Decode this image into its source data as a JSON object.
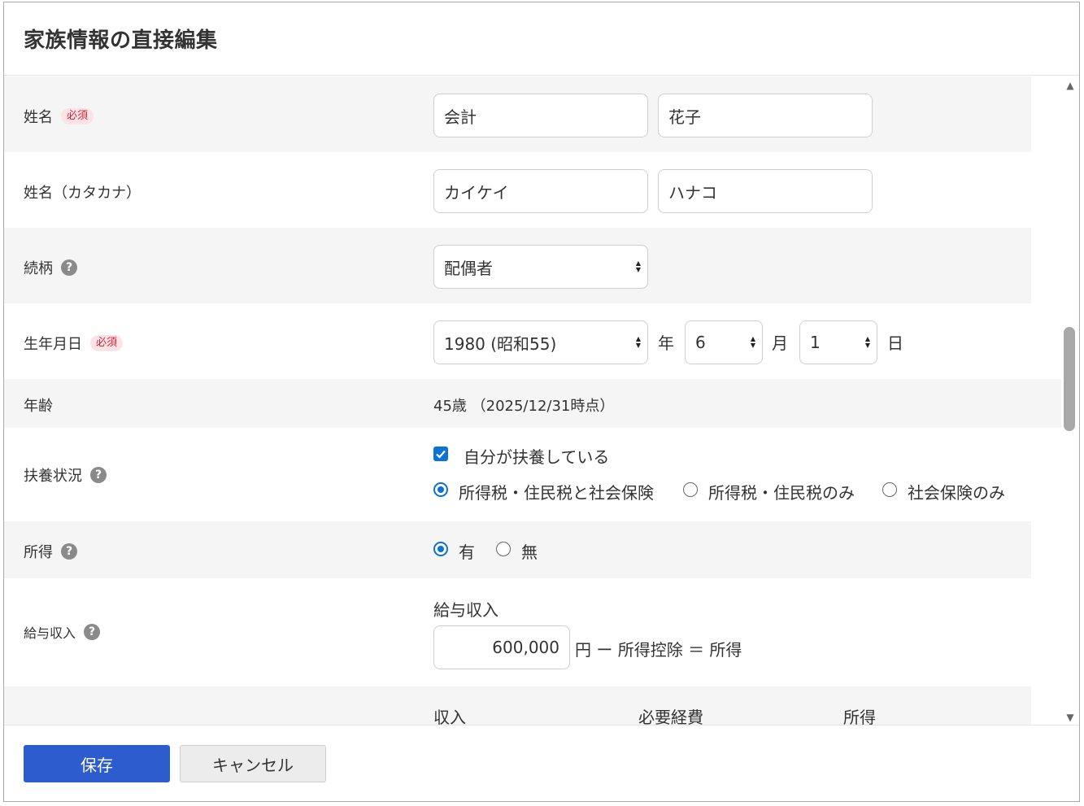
{
  "modal": {
    "title": "家族情報の直接編集"
  },
  "badges": {
    "required": "必須",
    "help": "?"
  },
  "form": {
    "name": {
      "label": "姓名",
      "last": "会計",
      "first": "花子"
    },
    "kana": {
      "label": "姓名（カタカナ）",
      "last": "カイケイ",
      "first": "ハナコ"
    },
    "relation": {
      "label": "続柄",
      "value": "配偶者"
    },
    "birthday": {
      "label": "生年月日",
      "year": "1980 (昭和55)",
      "year_unit": "年",
      "month": "6",
      "month_unit": "月",
      "day": "1",
      "day_unit": "日"
    },
    "age": {
      "label": "年齢",
      "value": "45歳 （2025/12/31時点）"
    },
    "dependent": {
      "label": "扶養状況",
      "checkbox_label": "自分が扶養している",
      "checked": true,
      "options": [
        "所得税・住民税と社会保険",
        "所得税・住民税のみ",
        "社会保険のみ"
      ],
      "selected": "所得税・住民税と社会保険"
    },
    "income": {
      "label": "所得",
      "options": [
        "有",
        "無"
      ],
      "selected": "有"
    },
    "salary": {
      "label": "給与収入",
      "sub_label": "給与収入",
      "amount": "600,000",
      "formula": "円 ー 所得控除 ＝ 所得"
    },
    "table_header": {
      "col1": "収入",
      "col2": "必要経費",
      "col3": "所得"
    }
  },
  "footer": {
    "save": "保存",
    "cancel": "キャンセル"
  },
  "colors": {
    "primary": "#2d5ccf",
    "accent": "#0b72d6",
    "required_bg": "#fde3e6",
    "required_text": "#c8283c"
  }
}
